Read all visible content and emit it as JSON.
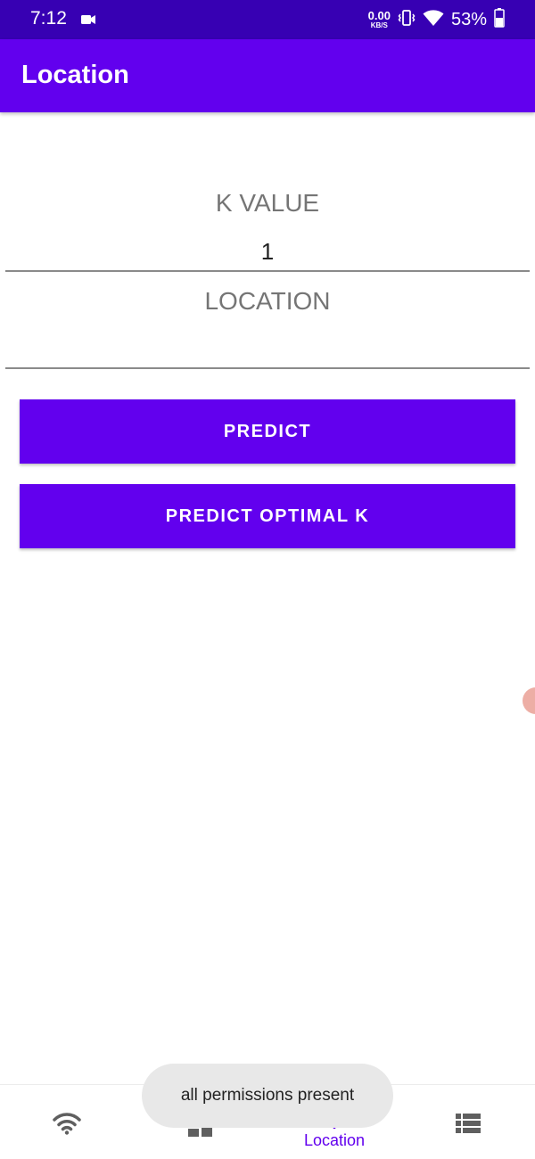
{
  "status_bar": {
    "time": "7:12",
    "net_speed_value": "0.00",
    "net_speed_unit": "KB/S",
    "battery": "53%"
  },
  "app_bar": {
    "title": "Location"
  },
  "form": {
    "k_value_label": "K VALUE",
    "k_value": "1",
    "location_label": "LOCATION",
    "location_value": ""
  },
  "buttons": {
    "predict": "PREDICT",
    "predict_optimal_k": "PREDICT OPTIMAL K"
  },
  "bottom_nav": {
    "items": [
      {
        "icon": "wifi-icon",
        "label": ""
      },
      {
        "icon": "dashboard-icon",
        "label": ""
      },
      {
        "icon": "location-target-icon",
        "label": "Location",
        "active": true
      },
      {
        "icon": "list-icon",
        "label": ""
      }
    ]
  },
  "toast": {
    "message": "all permissions present"
  },
  "colors": {
    "primary": "#6200ee",
    "primary_dark": "#3700b3",
    "nav_inactive": "#5f5f5f"
  }
}
